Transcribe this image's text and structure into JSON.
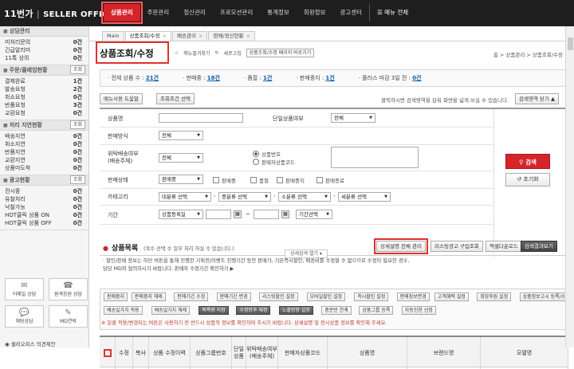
{
  "brand": {
    "logo": "11번가",
    "divider": "|",
    "name": "SELLER OFFICE"
  },
  "gnb": [
    {
      "label": "상품관리",
      "active": true
    },
    {
      "label": "주문관리"
    },
    {
      "label": "정산관리"
    },
    {
      "label": "프로모션관리"
    },
    {
      "label": "통계정보"
    },
    {
      "label": "회원정보"
    },
    {
      "label": "광고센터"
    },
    {
      "label": "☰ 메뉴 전체",
      "all": true
    }
  ],
  "sidebar": {
    "sections": [
      {
        "title": "상담관리",
        "quick": "",
        "rows": [
          [
            "미처리문의",
            "0건"
          ],
          [
            "긴급알리미",
            "0건"
          ],
          [
            "11톡 상의",
            "0건"
          ]
        ]
      },
      {
        "title": "주문/클레임현황",
        "quick": "조회",
        "rows": [
          [
            "결제완료",
            "1건"
          ],
          [
            "발송요청",
            "2건"
          ],
          [
            "취소요청",
            "0건"
          ],
          [
            "반품요청",
            "3건"
          ],
          [
            "교환요청",
            "0건"
          ]
        ]
      },
      {
        "title": "처리 지연현황",
        "quick": "조회",
        "rows": [
          [
            "배송지연",
            "0건"
          ],
          [
            "취소지연",
            "0건"
          ],
          [
            "반품지연",
            "0건"
          ],
          [
            "교환지연",
            "0건"
          ],
          [
            "상품미도착",
            "0건"
          ]
        ]
      },
      {
        "title": "광고현황",
        "quick": "조회",
        "rows": [
          [
            "전시중",
            "0건"
          ],
          [
            "유찰처리",
            "0건"
          ],
          [
            "낙찰가능",
            "0건"
          ],
          [
            "HOT클릭 상품 ON",
            "0건"
          ],
          [
            "HOT클릭 상품 OFF",
            "0건"
          ]
        ]
      }
    ],
    "shortcuts": [
      {
        "icon": "✉",
        "label": "이메일 상담"
      },
      {
        "icon": "☎",
        "label": "원격응원 상담"
      },
      {
        "icon": "💬",
        "label": "채팅상담"
      },
      {
        "icon": "✎",
        "label": "MD연락"
      }
    ],
    "feedback": "셀러오피스 의견제안"
  },
  "tabs": [
    {
      "label": "Main"
    },
    {
      "label": "상품조회/수정",
      "on": true
    },
    {
      "label": "배송관리"
    },
    {
      "label": "판매/정산현황"
    }
  ],
  "page": {
    "title": "상품조회/수정",
    "subnav": [
      "매뉴즐겨찾기",
      "새로고침",
      "상품조회/수정 페이지 바로가기"
    ],
    "breadcrumb": "홈 > 상품관리 > 상품조회/수정"
  },
  "summary": [
    {
      "label": "· 전체 상품 수 :",
      "val": "21건"
    },
    {
      "label": "· 판매중 :",
      "val": "18건"
    },
    {
      "label": "· 품절 :",
      "val": "1건"
    },
    {
      "label": "· 판매중지 :",
      "val": "1건"
    },
    {
      "label": "· 플러스 마감 3일 전 :",
      "val": "0건"
    }
  ],
  "actions": {
    "b1": "메뉴사용 도움말",
    "b2": "조회조건 선택",
    "note": "클릭하시면 검색영역을 감춰 화면을 넓게 쓰실 수 있습니다.",
    "b3": "검색영역 닫기 ▲"
  },
  "form": {
    "productName": "상품명",
    "singleStatus": "단일상품여부",
    "singleVal": "전체",
    "saleType": "판매방식",
    "saleVal": "전체",
    "consign": "위탁배송여부\n(배송주체)",
    "consignVal": "전체",
    "radio1": "상품번호",
    "radio2": "판매자상품코드",
    "status": "판매상태",
    "statusVal": "판매중",
    "chk": [
      "판매중",
      "품절",
      "판매중지",
      "판매종료"
    ],
    "category": "카테고리",
    "cats": [
      "대분류 선택",
      "중분류 선택",
      "소분류 선택",
      "세분류 선택"
    ],
    "period": "기간",
    "periodType": "상품등록일",
    "periodOpt": "기간선택",
    "tilde": "~",
    "collapse": "상세검색 열기 ▾",
    "search": "검색",
    "reset": "초기화"
  },
  "list": {
    "title": "상품목록",
    "sub": "(복수 선택 수 일부 처리 하실 수 있습니다.)",
    "btns": [
      "상세설명 전체 관리",
      "리스팅광고 구입조회",
      "엑셀다운로드",
      "검색결과보기"
    ],
    "notes": [
      "· 할인/판매 정보는 하단 버튼을 통해 진행한 기획전/이벤트 진행기간 동안 판매가, 기본즉시할인, 배송비를 수정할 수 없으므로 수정이 필요한 경우,",
      "  담당 MD와 협의하시기 바랍니다. 판매자 수정기간 확인하기 ▶"
    ],
    "row1": [
      "판매중지",
      "판매중지 해제",
      "판매기간 수정",
      "판매기간 변경",
      "리스팅할인 설정",
      "모바일할인 설정",
      "즉시할인 설정",
      "판매정보변경",
      "고객혜택 설정",
      "희망후원 설정",
      "상품정보고시 등록/수정"
    ],
    "row2": [
      "배송일가치 적용",
      "배송일가치 해제",
      "복록량 지정",
      "수정방후 재정",
      "노출방향 설정",
      "중분반 연계",
      "상품그룹 등록",
      "자동진한 선정"
    ],
    "warn": "※ 일괄 적용/변경되는 버튼은 사용하기 전 반드시 상품의 정보를 확인하여 주시기 바랍니다. 상세설명 및 전시상품 정보를 확인해 주세요.",
    "headers": [
      "",
      "수정",
      "복사",
      "상품 수정이력",
      "상품그룹번호",
      "단일 상품",
      "위탁배송여부\n(배송주체)",
      "판매자상품코드",
      "상품명",
      "브랜드명",
      "모델명"
    ]
  }
}
